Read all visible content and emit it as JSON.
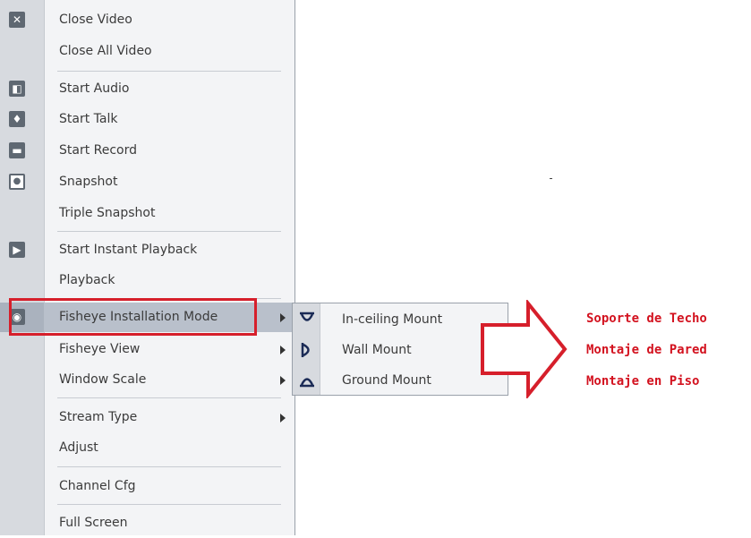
{
  "menu": {
    "items": [
      {
        "label": "Close Video",
        "icon": "close-icon"
      },
      {
        "label": "Close All Video",
        "icon": ""
      },
      {
        "label": "Start Audio",
        "icon": "audio-icon"
      },
      {
        "label": "Start Talk",
        "icon": "microphone-icon"
      },
      {
        "label": "Start Record",
        "icon": "record-icon"
      },
      {
        "label": "Snapshot",
        "icon": "camera-icon"
      },
      {
        "label": "Triple Snapshot",
        "icon": ""
      },
      {
        "label": "Start Instant Playback",
        "icon": "playback-icon"
      },
      {
        "label": "Playback",
        "icon": ""
      },
      {
        "label": "Fisheye Installation Mode",
        "icon": "eye-icon",
        "submenu": true,
        "active": true
      },
      {
        "label": "Fisheye View",
        "icon": "",
        "submenu": true
      },
      {
        "label": "Window Scale",
        "icon": "",
        "submenu": true
      },
      {
        "label": "Stream Type",
        "icon": "",
        "submenu": true
      },
      {
        "label": "Adjust",
        "icon": ""
      },
      {
        "label": "Channel Cfg",
        "icon": ""
      },
      {
        "label": "Full Screen",
        "icon": ""
      }
    ]
  },
  "submenu": {
    "items": [
      {
        "label": "In-ceiling Mount",
        "icon": "ceiling-mount-icon"
      },
      {
        "label": "Wall Mount",
        "icon": "wall-mount-icon"
      },
      {
        "label": "Ground Mount",
        "icon": "ground-mount-icon"
      }
    ]
  },
  "annotations": [
    "Soporte de Techo",
    "Montaje de Pared",
    "Montaje en Piso"
  ],
  "colors": {
    "highlight": "#d61f2b",
    "annotation_text": "#d3121f",
    "active_row": "#b9c0cb"
  }
}
